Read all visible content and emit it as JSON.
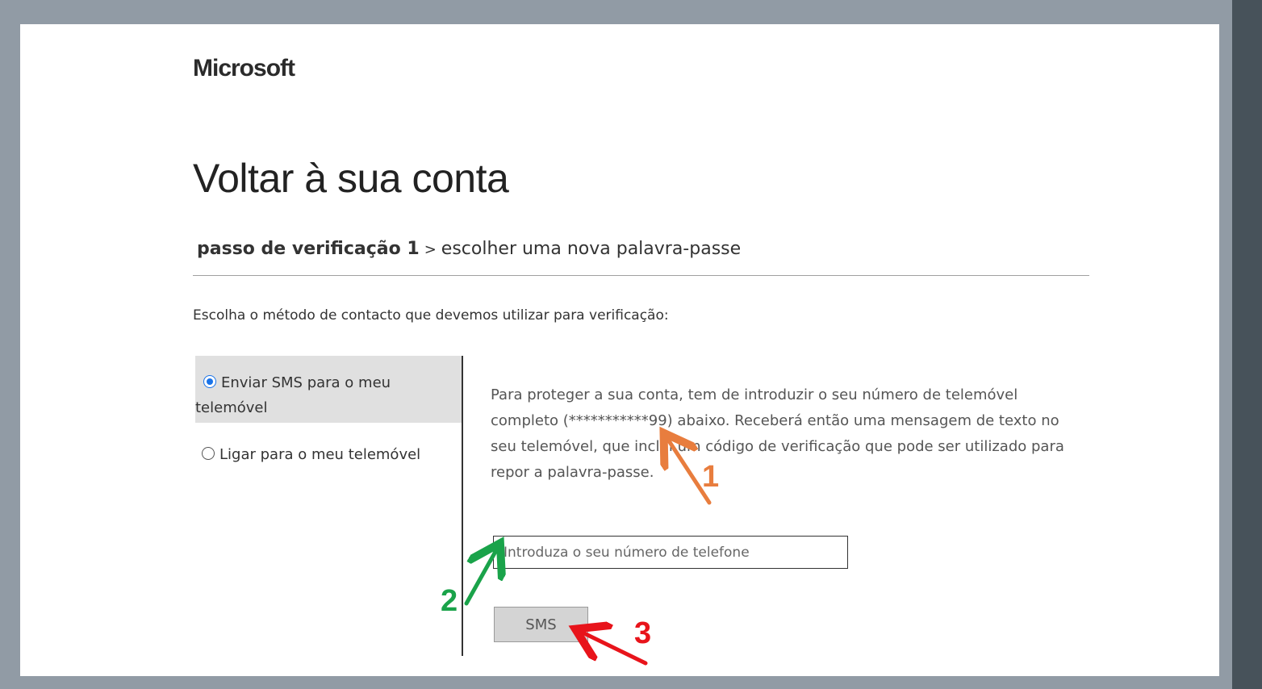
{
  "header": {
    "logo": "Microsoft",
    "title": "Voltar à sua conta"
  },
  "steps": {
    "current": "passo de verificação 1",
    "separator": ">",
    "next": "escolher uma nova palavra-passe"
  },
  "instruction": "Escolha o método de contacto que devemos utilizar para verificação:",
  "methods": [
    {
      "label": "Enviar SMS para o meu telemóvel",
      "selected": true
    },
    {
      "label": "Ligar para o meu telemóvel",
      "selected": false
    }
  ],
  "description": "Para proteger a sua conta, tem de introduzir o seu número de telemóvel completo (***********99) abaixo. Receberá então uma mensagem de texto no seu telemóvel, que inclui um código de verificação que pode ser utilizado para repor a palavra-passe.",
  "phone_input": {
    "value": "",
    "placeholder": "Introduza o seu número de telefone"
  },
  "sms_button": {
    "label": "SMS"
  },
  "annotations": [
    {
      "label": "1",
      "color": "#e87d3e"
    },
    {
      "label": "2",
      "color": "#1aa34a"
    },
    {
      "label": "3",
      "color": "#e8141b"
    }
  ],
  "colors": {
    "page_background": "#919ba5",
    "side_strip": "#47525a",
    "radio_accent": "#1a73e8",
    "selected_option_bg": "#e0e0e0"
  }
}
